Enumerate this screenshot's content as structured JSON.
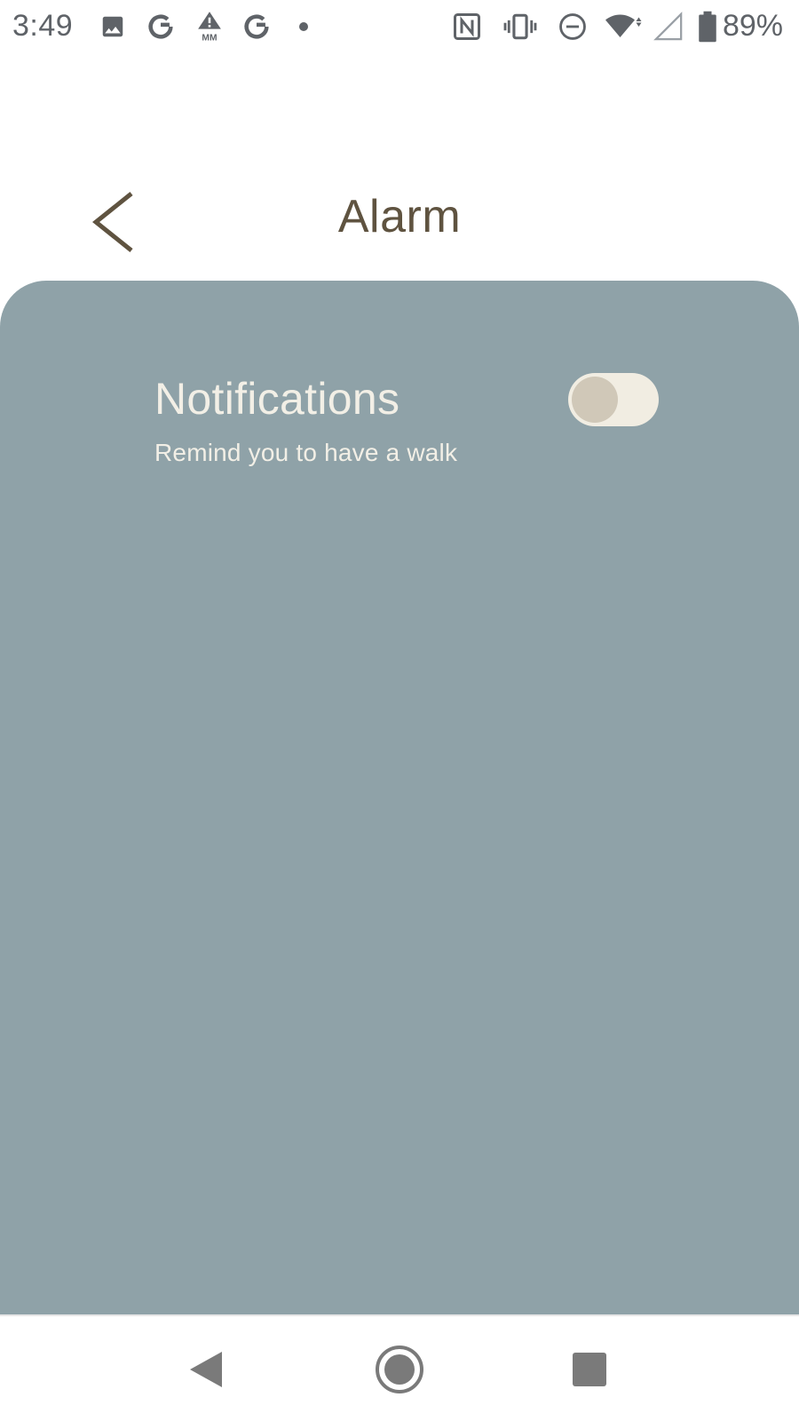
{
  "status_bar": {
    "time": "3:49",
    "battery_percent": "89%",
    "icons_left": [
      "image-icon",
      "google-g-icon",
      "mm-warning-icon",
      "google-g-icon",
      "dot-icon"
    ],
    "icons_right": [
      "nfc-icon",
      "vibrate-icon",
      "do-not-disturb-icon",
      "wifi-icon",
      "cell-signal-icon",
      "battery-icon"
    ]
  },
  "app_bar": {
    "title": "Alarm",
    "back_icon": "chevron-left-icon"
  },
  "settings": {
    "notifications": {
      "title": "Notifications",
      "subtitle": "Remind you to have a walk",
      "enabled": false
    }
  },
  "colors": {
    "card_background": "#8fa2a8",
    "title_color": "#5f5340",
    "text_light": "#f2efe6",
    "toggle_track": "#f1ede2",
    "toggle_thumb": "#d0c8b8"
  },
  "nav_bar": {
    "back_icon": "triangle-back-icon",
    "home_icon": "circle-home-icon",
    "recents_icon": "square-recents-icon"
  }
}
